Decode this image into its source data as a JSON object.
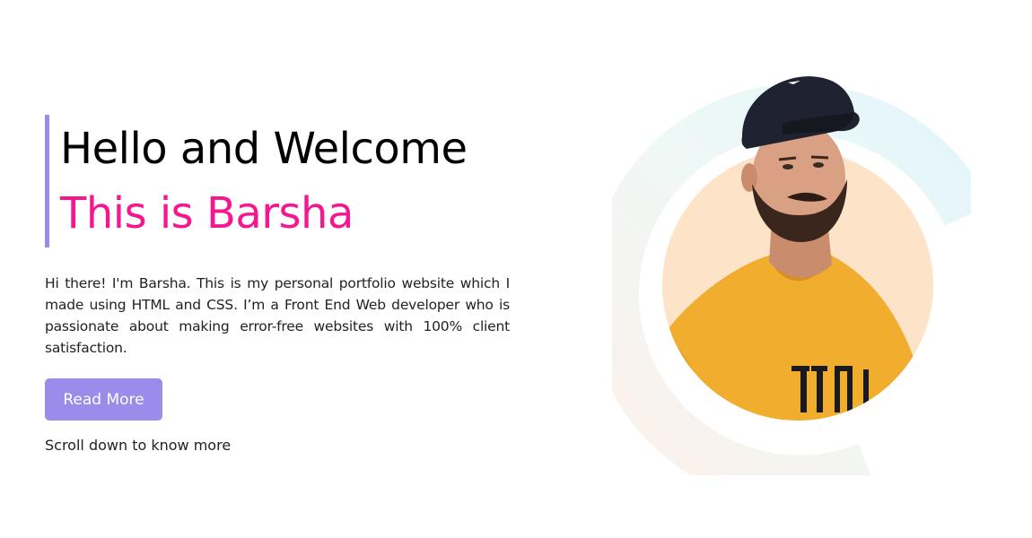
{
  "hero": {
    "heading_line1": "Hello and Welcome",
    "heading_line2": "This is Barsha",
    "intro": "Hi there! I'm Barsha. This is my personal portfolio website which I made using HTML and CSS. I’m a Front End Web developer who is passionate about making error-free websites with 100% client satisfaction.",
    "read_more_label": "Read More",
    "scroll_hint": "Scroll down to know more"
  },
  "colors": {
    "accent": "#9b8bea",
    "highlight": "#f5178f",
    "circle_fill": "#fde3c8",
    "shirt": "#f0ad2e"
  },
  "portrait": {
    "icon": "profile-photo",
    "shirt_print": "100L"
  }
}
